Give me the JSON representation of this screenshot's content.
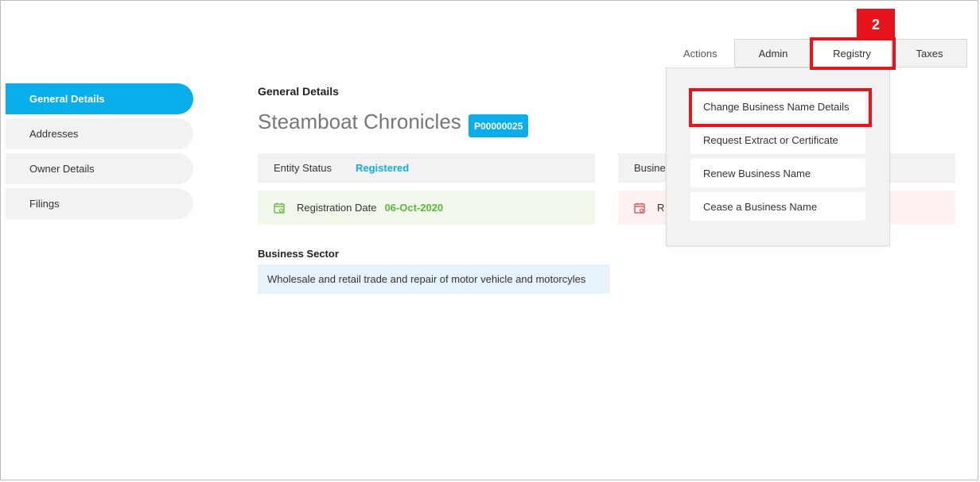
{
  "sidebar": {
    "items": [
      {
        "label": "General Details"
      },
      {
        "label": "Addresses"
      },
      {
        "label": "Owner Details"
      },
      {
        "label": "Filings"
      }
    ]
  },
  "main": {
    "section_title": "General Details",
    "entity_name": "Steamboat Chronicles",
    "entity_id": "P00000025",
    "status_label": "Entity Status",
    "status_value": "Registered",
    "business_label_partial": "Busine",
    "registration_label": "Registration Date",
    "registration_value": "06-Oct-2020",
    "second_date_label_partial": "R",
    "sector_title": "Business Sector",
    "sector_value": "Wholesale and retail trade and repair of motor vehicle and motorcyles"
  },
  "tabs": {
    "actions_label": "Actions",
    "items": [
      {
        "label": "Admin"
      },
      {
        "label": "Registry"
      },
      {
        "label": "Taxes"
      }
    ],
    "active": "Registry"
  },
  "dropdown": {
    "items": [
      {
        "label": "Change Business Name Details"
      },
      {
        "label": "Request Extract or Certificate"
      },
      {
        "label": "Renew Business Name"
      },
      {
        "label": "Cease a Business Name"
      }
    ]
  },
  "annotation": {
    "step_number": "2",
    "highlight_color": "#e8141c"
  },
  "colors": {
    "accent": "#0aaeea",
    "success": "#5cb83a",
    "danger_icon": "#e0474c"
  }
}
